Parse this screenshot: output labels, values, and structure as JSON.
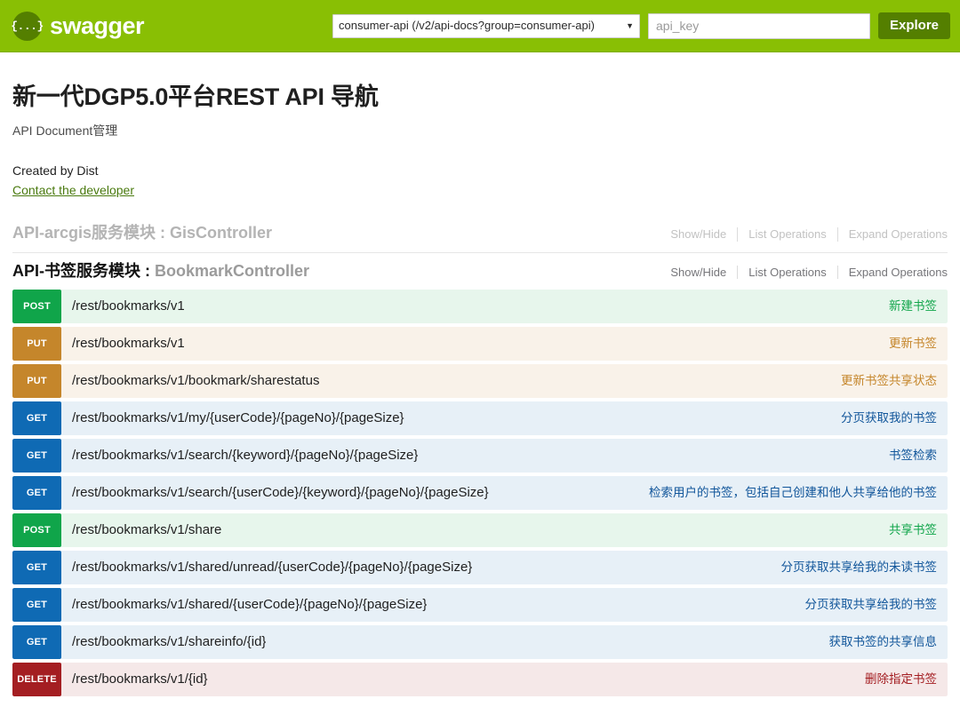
{
  "topbar": {
    "logo_icon": "swagger-braces-icon",
    "logo_glyph": "{...}",
    "brand_name": "swagger",
    "select": {
      "selected": "consumer-api (/v2/api-docs?group=consumer-api)",
      "caret_icon": "chevron-down-icon",
      "caret_glyph": "▼"
    },
    "api_key": {
      "value": "",
      "placeholder": "api_key"
    },
    "explore_label": "Explore",
    "background_color": "#89bf04",
    "button_color": "#547f00"
  },
  "info": {
    "title": "新一代DGP5.0平台REST API 导航",
    "subtitle": "API Document管理",
    "created_by": "Created by Dist",
    "contact_link": "Contact the developer"
  },
  "resource_options": {
    "show_hide": "Show/Hide",
    "list_operations": "List Operations",
    "expand_operations": "Expand Operations"
  },
  "resources": [
    {
      "name": "API-arcgis服务模块",
      "separator": " : ",
      "controller": "GisController",
      "state": "dim",
      "operations": []
    },
    {
      "name": "API-书签服务模块",
      "separator": " : ",
      "controller": "BookmarkController",
      "state": "strong",
      "operations": [
        {
          "method": "POST",
          "path": "/rest/bookmarks/v1",
          "description": "新建书签"
        },
        {
          "method": "PUT",
          "path": "/rest/bookmarks/v1",
          "description": "更新书签"
        },
        {
          "method": "PUT",
          "path": "/rest/bookmarks/v1/bookmark/sharestatus",
          "description": "更新书签共享状态"
        },
        {
          "method": "GET",
          "path": "/rest/bookmarks/v1/my/{userCode}/{pageNo}/{pageSize}",
          "description": "分页获取我的书签"
        },
        {
          "method": "GET",
          "path": "/rest/bookmarks/v1/search/{keyword}/{pageNo}/{pageSize}",
          "description": "书签检索"
        },
        {
          "method": "GET",
          "path": "/rest/bookmarks/v1/search/{userCode}/{keyword}/{pageNo}/{pageSize}",
          "description": "检索用户的书签，包括自己创建和他人共享给他的书签"
        },
        {
          "method": "POST",
          "path": "/rest/bookmarks/v1/share",
          "description": "共享书签"
        },
        {
          "method": "GET",
          "path": "/rest/bookmarks/v1/shared/unread/{userCode}/{pageNo}/{pageSize}",
          "description": "分页获取共享给我的未读书签"
        },
        {
          "method": "GET",
          "path": "/rest/bookmarks/v1/shared/{userCode}/{pageNo}/{pageSize}",
          "description": "分页获取共享给我的书签"
        },
        {
          "method": "GET",
          "path": "/rest/bookmarks/v1/shareinfo/{id}",
          "description": "获取书签的共享信息"
        },
        {
          "method": "DELETE",
          "path": "/rest/bookmarks/v1/{id}",
          "description": "删除指定书签"
        }
      ]
    }
  ],
  "method_colors": {
    "GET": "#0f6ab4",
    "POST": "#10a54a",
    "PUT": "#c5862b",
    "DELETE": "#a41e22"
  }
}
